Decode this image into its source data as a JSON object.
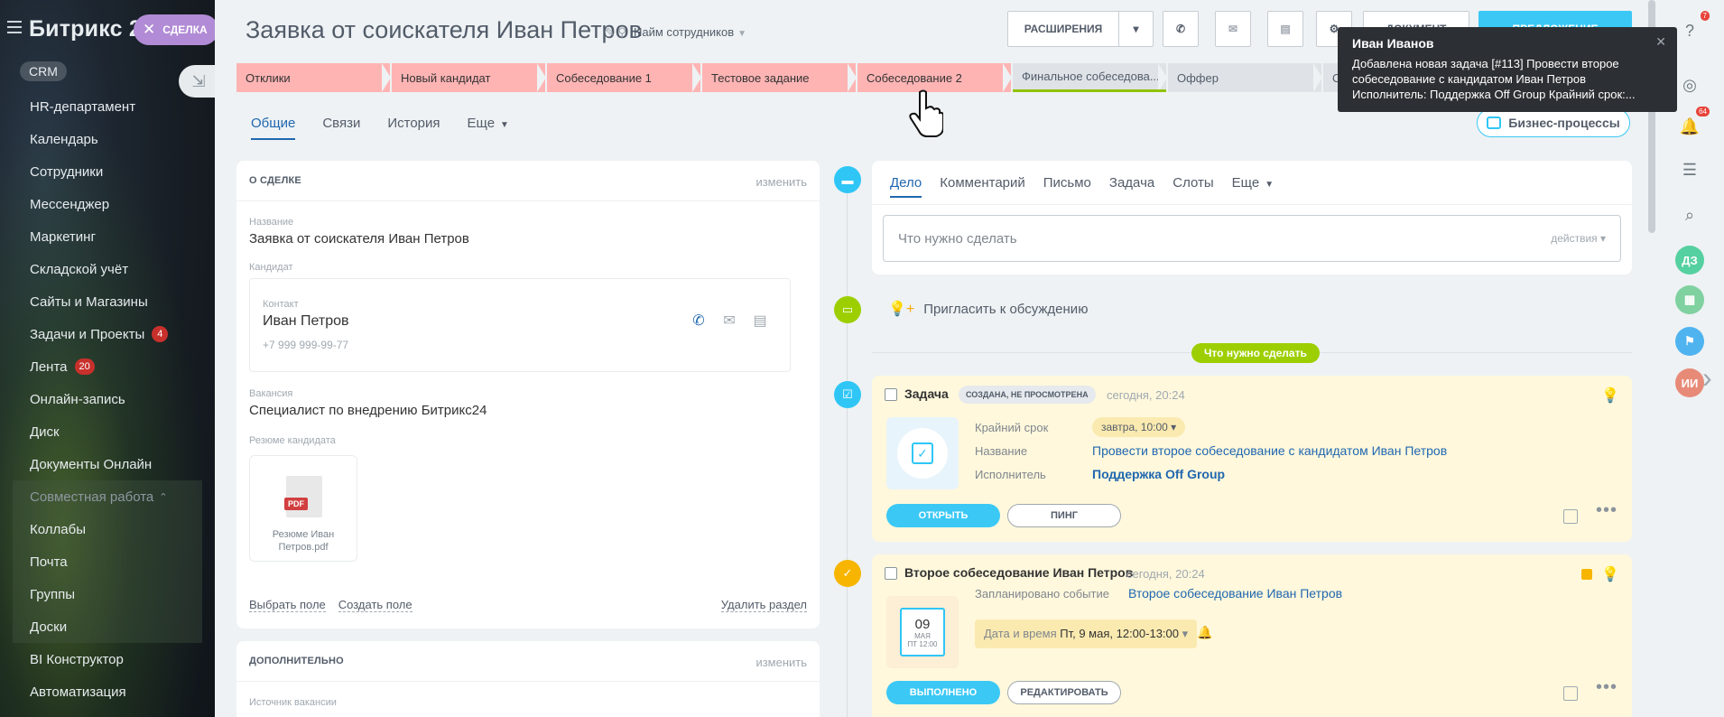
{
  "sidebar": {
    "logo": "Битрикс 2",
    "deal_chip": "СДЕЛКА",
    "crm_pill": "CRM",
    "items": [
      {
        "label": "HR-департамент"
      },
      {
        "label": "Календарь"
      },
      {
        "label": "Сотрудники"
      },
      {
        "label": "Мессенджер"
      },
      {
        "label": "Маркетинг"
      },
      {
        "label": "Складской учёт"
      },
      {
        "label": "Сайты и Магазины"
      },
      {
        "label": "Задачи и Проекты",
        "badge": "4"
      },
      {
        "label": "Лента",
        "badge": "20"
      },
      {
        "label": "Онлайн-запись"
      },
      {
        "label": "Диск"
      },
      {
        "label": "Документы Онлайн"
      }
    ],
    "group": {
      "label": "Совместная работа"
    },
    "group_items": [
      {
        "label": "Коллабы"
      },
      {
        "label": "Почта"
      },
      {
        "label": "Группы"
      },
      {
        "label": "Доски"
      }
    ],
    "tail_items": [
      {
        "label": "BI Конструктор"
      },
      {
        "label": "Автоматизация"
      }
    ]
  },
  "header": {
    "title": "Заявка от соискателя Иван Петров",
    "subtitle": "Найм сотрудников",
    "extensions_label": "РАСШИРЕНИЯ",
    "document_label": "ДОКУМЕНТ",
    "proposal_label": "ПРЕДЛОЖЕНИЕ"
  },
  "stages": [
    {
      "label": "Отклики",
      "state": "done"
    },
    {
      "label": "Новый кандидат",
      "state": "done"
    },
    {
      "label": "Собеседование 1",
      "state": "done"
    },
    {
      "label": "Тестовое задание",
      "state": "done"
    },
    {
      "label": "Собеседование 2",
      "state": "done"
    },
    {
      "label": "Финальное собеседова...",
      "state": "todo"
    },
    {
      "label": "Оффер",
      "state": "todo"
    },
    {
      "label": "О",
      "state": "todo"
    }
  ],
  "tabs": {
    "general": "Общие",
    "links": "Связи",
    "history": "История",
    "more": "Еще"
  },
  "biz_processes": "Бизнес-процессы",
  "about": {
    "heading": "О СДЕЛКЕ",
    "edit": "изменить",
    "name_label": "Название",
    "name_value": "Заявка от соискателя Иван Петров",
    "candidate_label": "Кандидат",
    "contact_label": "Контакт",
    "contact_name": "Иван Петров",
    "contact_phone": "+7 999 999-99-77",
    "vacancy_label": "Вакансия",
    "vacancy_value": "Специалист по внедрению Битрикс24",
    "resume_label": "Резюме кандидата",
    "resume_file": "Резюме Иван Петров.pdf",
    "pdf_tag": "PDF",
    "select_field": "Выбрать поле",
    "create_field": "Создать поле",
    "delete_section": "Удалить раздел"
  },
  "additional": {
    "heading": "ДОПОЛНИТЕЛЬНО",
    "edit": "изменить",
    "source_label": "Источник вакансии"
  },
  "editor": {
    "tabs": [
      "Дело",
      "Комментарий",
      "Письмо",
      "Задача",
      "Слоты",
      "Еще"
    ],
    "placeholder": "Что нужно сделать",
    "actions": "действия"
  },
  "invite": "Пригласить к обсуждению",
  "todo_pill": "Что нужно сделать",
  "task_card": {
    "title": "Задача",
    "badge": "СОЗДАНА, НЕ ПРОСМОТРЕНА",
    "time": "сегодня, 20:24",
    "deadline_label": "Крайний срок",
    "deadline_value": "завтра, 10:00",
    "name_label": "Название",
    "name_value": "Провести второе собеседование с кандидатом Иван Петров",
    "assignee_label": "Исполнитель",
    "assignee_value": "Поддержка Off Group",
    "open_btn": "ОТКРЫТЬ",
    "ping_btn": "ПИНГ"
  },
  "meet_card": {
    "title": "Второе собеседование Иван Петров",
    "time": "сегодня, 20:24",
    "event_label": "Запланировано событие",
    "event_value": "Второе собеседование Иван Петров",
    "cal_day": "09",
    "cal_month": "МАЯ",
    "cal_dow": "ПТ 12:00",
    "dt_label": "Дата и время",
    "dt_value": "Пт, 9 мая, 12:00-13:00",
    "done_btn": "ВЫПОЛНЕНО",
    "edit_btn": "РЕДАКТИРОВАТЬ"
  },
  "right_strip": {
    "badge_top": "7",
    "badge_bell": "64",
    "avatar_dz": "ДЗ",
    "avatar_ii": "ИИ"
  },
  "notification": {
    "title": "Иван Иванов",
    "body": "Добавлена новая задача [#113] Провести второе собеседование с кандидатом Иван Петров Исполнитель: Поддержка Off Group Крайний срок:..."
  },
  "colors": {
    "accent": "#3bc8f5",
    "link": "#2067b0",
    "stage_done": "#ffb4b4",
    "stage_todo": "#dfe3e8",
    "todo_green": "#9dcf00"
  }
}
